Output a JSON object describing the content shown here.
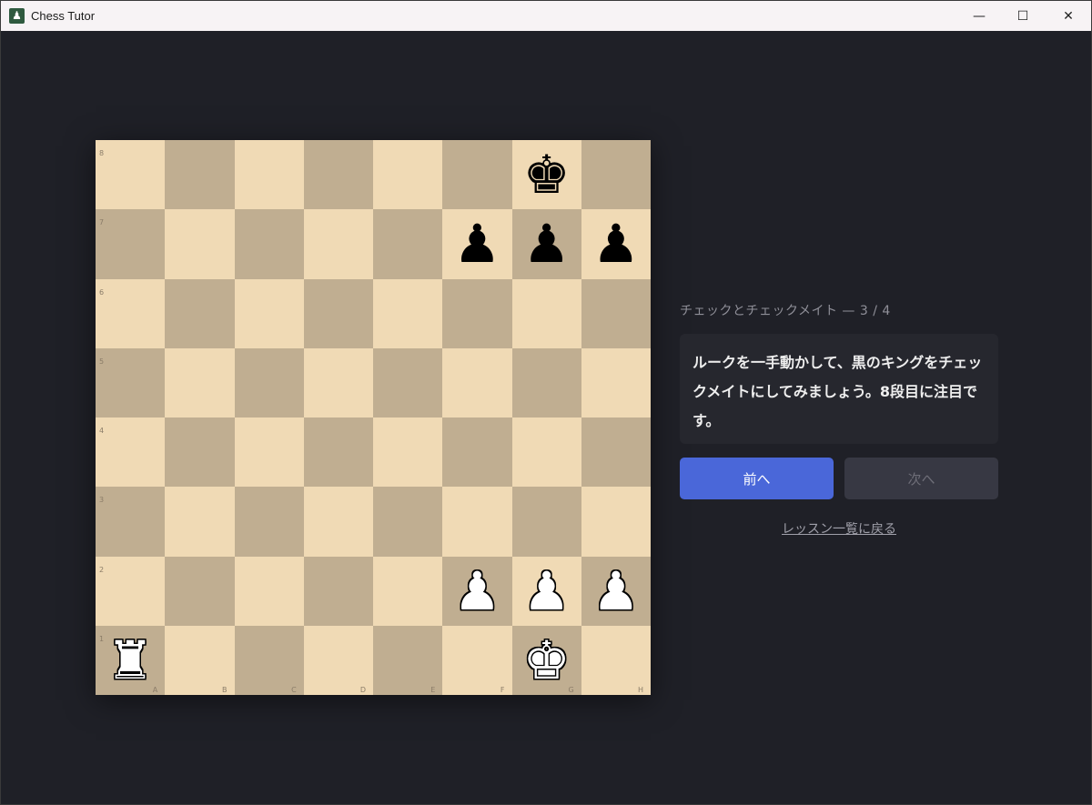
{
  "window": {
    "title": "Chess Tutor",
    "app_icon": "♟",
    "minimize": "—",
    "maximize": "☐",
    "close": "✕"
  },
  "board": {
    "ranks": [
      "8",
      "7",
      "6",
      "5",
      "4",
      "3",
      "2",
      "1"
    ],
    "files": [
      "A",
      "B",
      "C",
      "D",
      "E",
      "F",
      "G",
      "H"
    ],
    "colors": {
      "light": "#f0dab5",
      "dark": "#c0ae91"
    },
    "pieces": [
      {
        "square": "g8",
        "glyph": "♚",
        "color": "black",
        "name": "black-king"
      },
      {
        "square": "f7",
        "glyph": "♟",
        "color": "black",
        "name": "black-pawn-f7"
      },
      {
        "square": "g7",
        "glyph": "♟",
        "color": "black",
        "name": "black-pawn-g7"
      },
      {
        "square": "h7",
        "glyph": "♟",
        "color": "black",
        "name": "black-pawn-h7"
      },
      {
        "square": "f2",
        "glyph": "♟",
        "color": "white",
        "name": "white-pawn-f2"
      },
      {
        "square": "g2",
        "glyph": "♟",
        "color": "white",
        "name": "white-pawn-g2"
      },
      {
        "square": "h2",
        "glyph": "♟",
        "color": "white",
        "name": "white-pawn-h2"
      },
      {
        "square": "a1",
        "glyph": "♜",
        "color": "white",
        "name": "white-rook"
      },
      {
        "square": "g1",
        "glyph": "♚",
        "color": "white",
        "name": "white-king"
      }
    ]
  },
  "lesson": {
    "progress": "チェックとチェックメイト — 3 / 4",
    "instruction": "ルークを一手動かして、黒のキングをチェックメイトにしてみましょう。8段目に注目です。",
    "prev_label": "前へ",
    "next_label": "次へ",
    "back_link": "レッスン一覧に戻る"
  }
}
